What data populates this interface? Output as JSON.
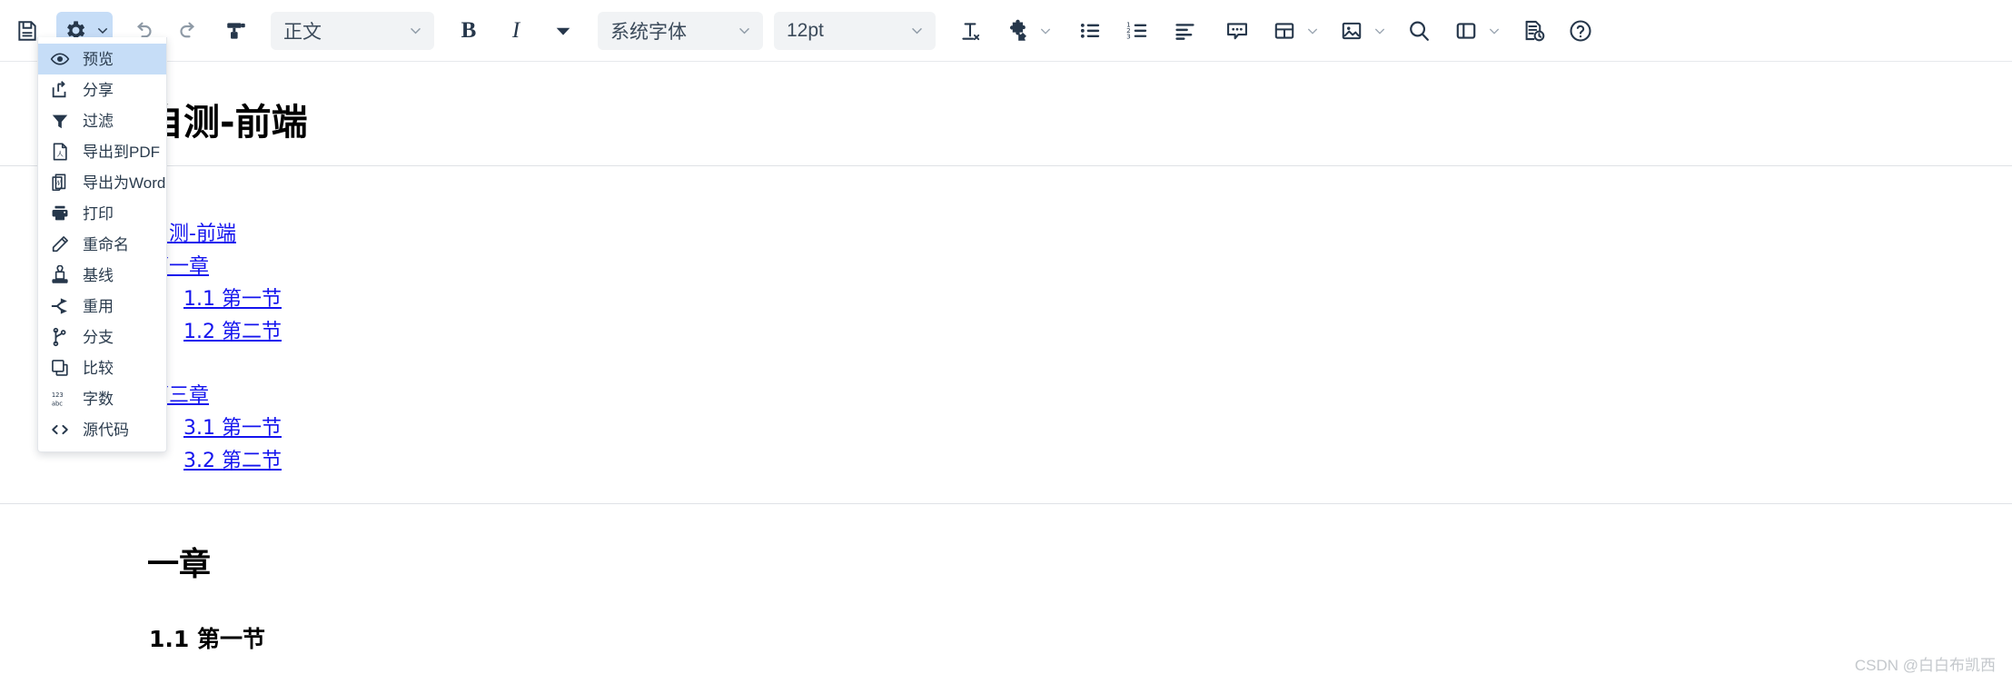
{
  "toolbar": {
    "items": [
      {
        "name": "save-icon",
        "label": "保存"
      },
      {
        "name": "settings-gear-icon",
        "label": "设置"
      },
      {
        "name": "undo-icon",
        "label": "撤销"
      },
      {
        "name": "redo-icon",
        "label": "重做"
      },
      {
        "name": "format-painter-icon",
        "label": "格式刷"
      },
      {
        "name": "bold-button",
        "label": "B"
      },
      {
        "name": "italic-button",
        "label": "I"
      },
      {
        "name": "more-format-icon",
        "label": "更多格式"
      },
      {
        "name": "clear-format-icon",
        "label": "清除格式"
      },
      {
        "name": "plugin-puzzle-icon",
        "label": "插件"
      },
      {
        "name": "bullet-list-icon",
        "label": "项目符号"
      },
      {
        "name": "numbered-list-icon",
        "label": "编号列表"
      },
      {
        "name": "align-left-icon",
        "label": "对齐"
      },
      {
        "name": "comment-icon",
        "label": "批注"
      },
      {
        "name": "table-icon",
        "label": "表格"
      },
      {
        "name": "image-icon",
        "label": "图片"
      },
      {
        "name": "search-icon",
        "label": "查找"
      },
      {
        "name": "panel-layout-icon",
        "label": "面板"
      },
      {
        "name": "doc-history-icon",
        "label": "历史"
      },
      {
        "name": "help-icon",
        "label": "帮助"
      }
    ],
    "style_select": {
      "value": "正文"
    },
    "font_select": {
      "value": "系统字体"
    },
    "size_select": {
      "value": "12pt"
    }
  },
  "menu": {
    "items": [
      {
        "label": "预览",
        "icon": "eye-icon",
        "selected": true
      },
      {
        "label": "分享",
        "icon": "share-icon",
        "selected": false
      },
      {
        "label": "过滤",
        "icon": "filter-icon",
        "selected": false
      },
      {
        "label": "导出到PDF",
        "icon": "export-pdf-icon",
        "selected": false
      },
      {
        "label": "导出为Word",
        "icon": "export-word-icon",
        "selected": false
      },
      {
        "label": "打印",
        "icon": "print-icon",
        "selected": false
      },
      {
        "label": "重命名",
        "icon": "pencil-rename-icon",
        "selected": false
      },
      {
        "label": "基线",
        "icon": "stamp-baseline-icon",
        "selected": false
      },
      {
        "label": "重用",
        "icon": "reuse-share-icon",
        "selected": false
      },
      {
        "label": "分支",
        "icon": "branch-icon",
        "selected": false
      },
      {
        "label": "比较",
        "icon": "compare-icon",
        "selected": false
      },
      {
        "label": "字数",
        "icon": "word-count-icon",
        "selected": false
      },
      {
        "label": "源代码",
        "icon": "source-code-icon",
        "selected": false
      }
    ]
  },
  "document": {
    "title": "自测-前端",
    "toc": [
      {
        "text": "自测-前端",
        "level": 1
      },
      {
        "text": "第一章",
        "level": 1
      },
      {
        "text": "1.1 第一节",
        "level": 2
      },
      {
        "text": "1.2 第二节",
        "level": 2
      },
      {
        "text": "",
        "level": 0
      },
      {
        "text": "第三章",
        "level": 1
      },
      {
        "text": "3.1 第一节",
        "level": 2
      },
      {
        "text": "3.2 第二节",
        "level": 2
      }
    ],
    "heading1": "一章",
    "heading2": "1.1 第一节"
  },
  "watermark": {
    "text": "CSDN @白白布凯西"
  },
  "colors": {
    "accent": "#c6ddf7",
    "icon": "#26374b",
    "link": "#1414ee",
    "field_bg": "#f1f3f5"
  }
}
